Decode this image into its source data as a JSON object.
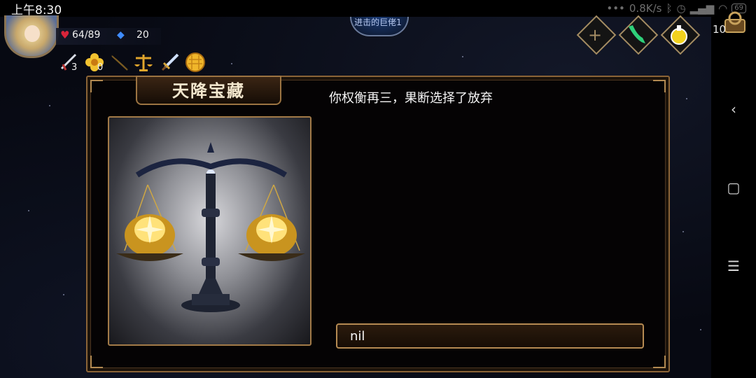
{
  "status_bar": {
    "time": "上午8:30",
    "more": "•••",
    "speed": "0.8K/s",
    "battery": "69",
    "icons": [
      "bluetooth-icon",
      "alarm-icon",
      "signal-icon",
      "wifi-icon",
      "battery-icon"
    ]
  },
  "nav_bar": {
    "back": "‹",
    "home": "▢",
    "menu": "☰"
  },
  "player": {
    "name": "",
    "hp": "64/89",
    "gems": "20"
  },
  "inventory": [
    {
      "icon": "dagger-icon",
      "count": "3"
    },
    {
      "icon": "flower-icon",
      "count": "0"
    },
    {
      "icon": "drill-icon",
      "count": ""
    },
    {
      "icon": "scales-icon",
      "count": ""
    },
    {
      "icon": "sword-icon",
      "count": ""
    },
    {
      "icon": "golden-orb-icon",
      "count": ""
    }
  ],
  "top_banner": {
    "text": "进击的巨佬1"
  },
  "top_right": {
    "plus": "+",
    "chest_count": "10"
  },
  "dialog": {
    "title": "天降宝藏",
    "message": "你权衡再三，果断选择了放弃",
    "image_alt": "scales-with-gold",
    "choice_label": "nil"
  },
  "colors": {
    "frame_gold": "#a27a48",
    "dialog_bg": "#050304",
    "hp_red": "#d8243a",
    "gem_blue": "#3f8cff"
  }
}
